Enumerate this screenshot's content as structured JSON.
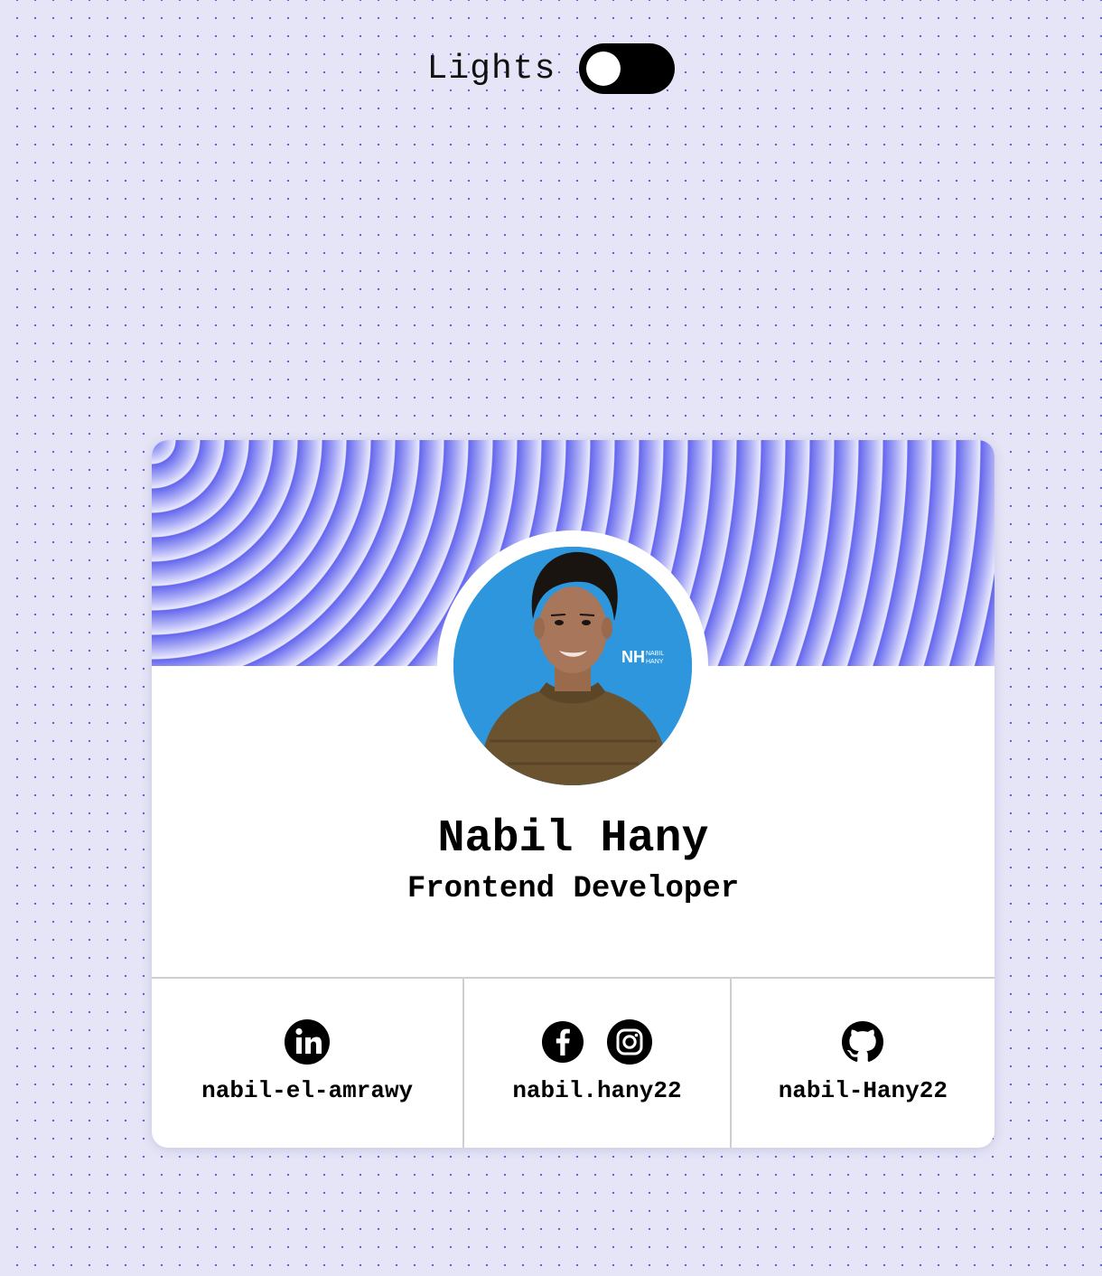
{
  "toggle": {
    "label": "Lights",
    "state": "off"
  },
  "profile": {
    "name": "Nabil Hany",
    "role": "Frontend Developer",
    "avatar_logo_initials": "NH",
    "avatar_logo_line1": "NABIL",
    "avatar_logo_line2": "HANY"
  },
  "socials": [
    {
      "icons": [
        "linkedin-icon"
      ],
      "handle": "nabil-el-amrawy"
    },
    {
      "icons": [
        "facebook-icon",
        "instagram-icon"
      ],
      "handle": "nabil.hany22"
    },
    {
      "icons": [
        "github-icon"
      ],
      "handle": "nabil-Hany22"
    }
  ],
  "colors": {
    "background": "#e6e5f7",
    "dots": "#5a5ae0",
    "banner_wave": "#6466ee",
    "avatar_bg": "#2d96dc",
    "toggle": "#000000"
  }
}
